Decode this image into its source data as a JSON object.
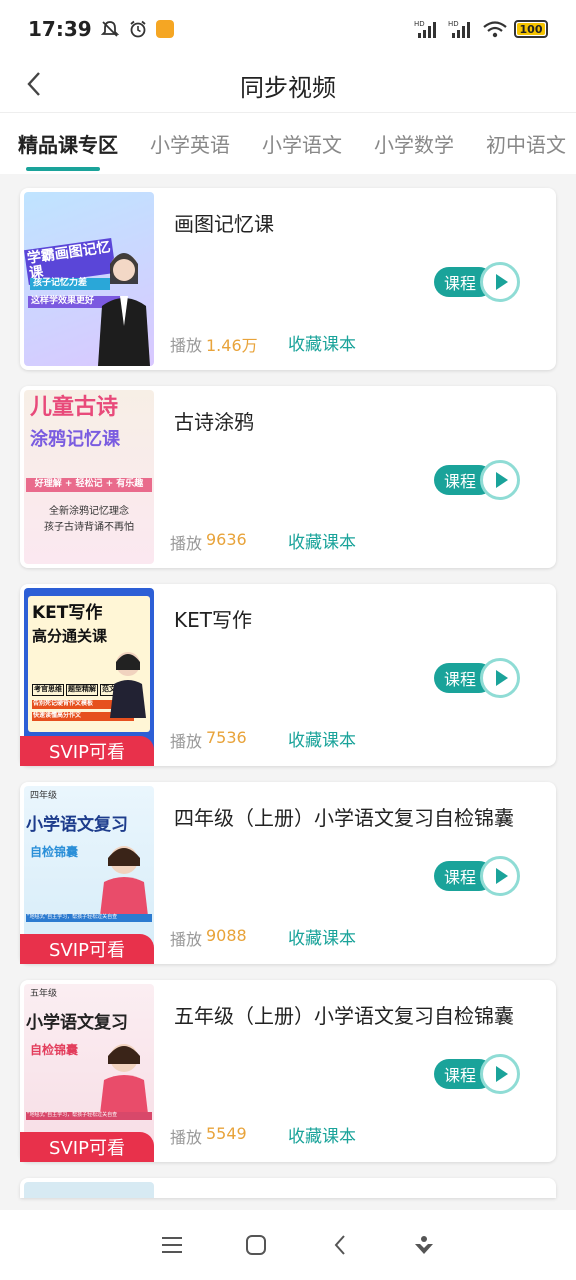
{
  "status_bar": {
    "time": "17:39",
    "battery": "100",
    "icons": [
      "bell-off-icon",
      "alarm-icon",
      "app-notification-icon",
      "hd-signal-icon",
      "hd-signal-icon",
      "wifi-icon",
      "battery-icon"
    ]
  },
  "header": {
    "title": "同步视频",
    "back_icon": "chevron-left-icon"
  },
  "tabs": [
    {
      "label": "精品课专区",
      "active": true
    },
    {
      "label": "小学英语",
      "active": false
    },
    {
      "label": "小学语文",
      "active": false
    },
    {
      "label": "小学数学",
      "active": false
    },
    {
      "label": "初中语文",
      "active": false
    }
  ],
  "course_button_label": "课程",
  "play_label": "播放",
  "collect_label": "收藏课本",
  "svip_label": "SVIP可看",
  "items": [
    {
      "title": "画图记忆课",
      "plays": "1.46万",
      "thumb_text": [
        "学霸画图记忆课",
        "孩子记忆力差",
        "这样学效果更好"
      ],
      "svip": false
    },
    {
      "title": "古诗涂鸦",
      "plays": "9636",
      "thumb_text": [
        "儿童古诗",
        "涂鸦记忆课",
        "好理解 + 轻松记 + 有乐趣",
        "全新涂鸦记忆理念",
        "孩子古诗背诵不再怕"
      ],
      "svip": false
    },
    {
      "title": "KET写作",
      "plays": "7536",
      "thumb_text": [
        "KET写作",
        "高分通关课",
        "考官思维",
        "题型精解",
        "范文分析",
        "告别死记硬背作文模板",
        "快速读懂高分作文"
      ],
      "svip": true
    },
    {
      "title": "四年级（上册）小学语文复习自检锦囊",
      "plays": "9088",
      "thumb_text": [
        "四年级",
        "小学语文复习",
        "自检锦囊",
        "“地毯式”自主学习，帮孩子轻松过关自查"
      ],
      "svip": true
    },
    {
      "title": "五年级（上册）小学语文复习自检锦囊",
      "plays": "5549",
      "thumb_text": [
        "五年级",
        "小学语文复习",
        "自检锦囊",
        "“地毯式”自主学习，帮孩子轻松过关自查"
      ],
      "svip": true
    }
  ],
  "nav_bar": [
    "menu-icon",
    "home-square-icon",
    "back-triangle-icon",
    "assistant-icon"
  ],
  "colors": {
    "accent": "#1aa39a",
    "svip": "#e8314b",
    "count": "#e8a33a"
  }
}
